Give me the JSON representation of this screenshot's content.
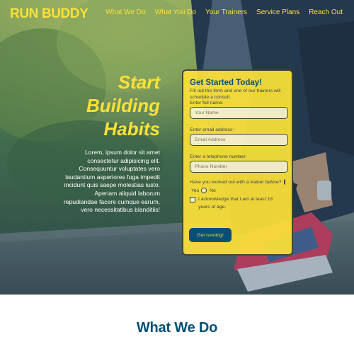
{
  "header": {
    "logo": "RUN BUDDY",
    "nav": [
      "What We Do",
      "What You Do",
      "Your Trainers",
      "Service Plans",
      "Reach Out"
    ]
  },
  "hero": {
    "heading": [
      "Start",
      "Building",
      "Habits"
    ],
    "body": "Lorem, ipsum dolor sit amet consectetur adipisicing elit. Consequuntur voluptates vero laudantium asperiores fuga impedit incidunt quis saepe molestias iusto. Aperiam aliquid laborum repudiandae facere cumque earum, vero necessitatibus blanditiis!"
  },
  "form": {
    "title": "Get Started Today!",
    "subtitle": "Fill out the form and one of our trainers will schedule a consult.",
    "name_label": "Enter full name:",
    "name_placeholder": "Your Name",
    "email_label": "Enter email address:",
    "email_placeholder": "Email Address",
    "phone_label": "Enter a telephone number:",
    "phone_placeholder": "Phone Number",
    "question": "Have you worked out with a trainer before?",
    "yes_label": "Yes",
    "no_label": "No",
    "ack_label": "I acknowledge that I am at least 18 years of age.",
    "submit_label": "Get running!"
  },
  "section": {
    "title": "What We Do"
  },
  "colors": {
    "brand_yellow": "#fce138",
    "brand_blue": "#024e76",
    "text_dark": "#39464e",
    "sneaker_pink": "#e23b5f"
  }
}
